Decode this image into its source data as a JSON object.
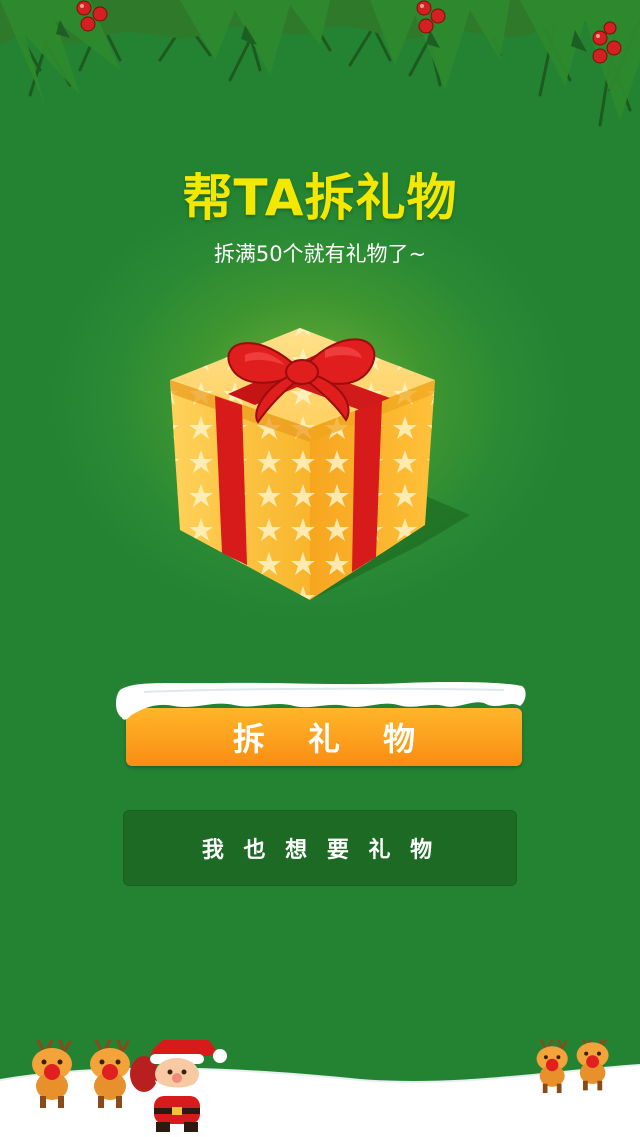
{
  "header": {
    "title": "帮TA拆礼物",
    "subtitle": "拆满50个就有礼物了~"
  },
  "actions": {
    "open_gift_label": "拆 礼 物",
    "want_gift_label": "我 也 想 要 礼 物"
  },
  "decor": {
    "garland": "pine-garland-with-holly-berries",
    "gift": "gift-box-icon",
    "characters": [
      "reindeer",
      "reindeer",
      "santa-claus",
      "reindeer",
      "reindeer"
    ]
  },
  "colors": {
    "background": "#2a8a34",
    "title": "#f5e800",
    "primary_button": "#f98d12",
    "secondary_button": "#1d6a24",
    "ribbon": "#d71a1a",
    "box": "#f7b52f"
  }
}
